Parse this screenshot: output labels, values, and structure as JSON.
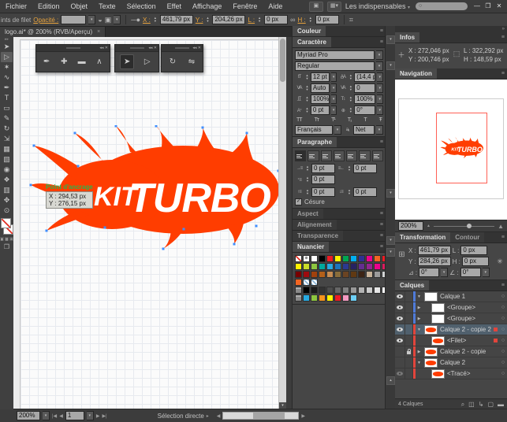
{
  "colors": {
    "logo": "#ff3d00",
    "accent_orange": "#e8a33d",
    "layer_blue": "#4f7bd8",
    "layer_red": "#e2453c",
    "selection_row": "#50606d",
    "nav_frame": "#ff6055",
    "anchor": "#3f8fff",
    "guide_green": "#2db34a"
  },
  "menubar": {
    "items": [
      "Fichier",
      "Edition",
      "Objet",
      "Texte",
      "Sélection",
      "Effet",
      "Affichage",
      "Fenêtre",
      "Aide"
    ],
    "workspace": "Les indispensables",
    "search_placeholder": "",
    "window_buttons": [
      "—",
      "❐",
      "✕"
    ]
  },
  "controlbar": {
    "context": "ints de filet",
    "opacity_label": "Opacité :",
    "opacity_value": "",
    "x_label": "X :",
    "x": "461,79 px",
    "y_label": "Y :",
    "y": "204,26 px",
    "l_label": "L :",
    "l": "0 px",
    "h_label": "H :",
    "h": "0 px"
  },
  "tabbar": {
    "title": "logo.ai* @ 200% (RVB/Aperçu)",
    "close": "×"
  },
  "toolbar": {
    "tools": [
      {
        "name": "selection-tool",
        "glyph": "➤"
      },
      {
        "name": "direct-selection-tool",
        "glyph": "▷",
        "active": true
      },
      {
        "name": "magic-wand-tool",
        "glyph": "✶"
      },
      {
        "name": "lasso-tool",
        "glyph": "∿"
      },
      {
        "name": "pen-tool",
        "glyph": "✒"
      },
      {
        "name": "type-tool",
        "glyph": "T"
      },
      {
        "name": "rectangle-tool",
        "glyph": "▭"
      },
      {
        "name": "pencil-tool",
        "glyph": "✎"
      },
      {
        "name": "rotate-tool",
        "glyph": "↻"
      },
      {
        "name": "scale-tool",
        "glyph": "⇲"
      },
      {
        "name": "mesh-tool",
        "glyph": "▦"
      },
      {
        "name": "gradient-tool",
        "glyph": "▧"
      },
      {
        "name": "eyedropper-tool",
        "glyph": "◉"
      },
      {
        "name": "blend-tool",
        "glyph": "❖"
      },
      {
        "name": "column-graph-tool",
        "glyph": "▥"
      },
      {
        "name": "hand-tool",
        "glyph": "✥"
      },
      {
        "name": "zoom-tool",
        "glyph": "⊙"
      }
    ]
  },
  "palettes": [
    {
      "name": "pen-tools-palette",
      "buttons": [
        {
          "name": "pen-tool",
          "glyph": "✒"
        },
        {
          "name": "add-anchor-point-tool",
          "glyph": "✚"
        },
        {
          "name": "delete-anchor-point-tool",
          "glyph": "▬"
        },
        {
          "name": "convert-anchor-point-tool",
          "glyph": "∧"
        }
      ]
    },
    {
      "name": "selection-tools-palette",
      "buttons": [
        {
          "name": "selection-tool",
          "glyph": "➤",
          "active": true
        },
        {
          "name": "direct-selection-tool",
          "glyph": "▷"
        }
      ]
    },
    {
      "name": "rotate-tools-palette",
      "buttons": [
        {
          "name": "rotate-tool",
          "glyph": "↻"
        },
        {
          "name": "reflect-tool",
          "glyph": "⇋"
        }
      ]
    }
  ],
  "canvas": {
    "tooltip": {
      "label": "Point d'ancrage",
      "x": "X : 294,53 px",
      "y": "Y : 276,15 px"
    }
  },
  "logo": {
    "kit": "KIT",
    "turbo": "TURBO",
    "anchors": [
      [
        6,
        26
      ],
      [
        2,
        76
      ],
      [
        22,
        134
      ],
      [
        58,
        10
      ],
      [
        110,
        1
      ],
      [
        161,
        1
      ],
      [
        220,
        3
      ],
      [
        276,
        10
      ],
      [
        316,
        58
      ],
      [
        318,
        102
      ],
      [
        288,
        128
      ],
      [
        260,
        151
      ],
      [
        196,
        132
      ],
      [
        170,
        157
      ],
      [
        96,
        130
      ],
      [
        62,
        52
      ]
    ]
  },
  "color_panel": {
    "title": "Couleur"
  },
  "character": {
    "title": "Caractère",
    "font": "Myriad Pro",
    "style": "Regular",
    "size": "12 pt",
    "leading": "(14,4 pt)",
    "kerning": "Auto",
    "tracking": "0",
    "h_scale": "100%",
    "v_scale": "100%",
    "baseline": "0 pt",
    "rotation": "0°",
    "tt_buttons": [
      "TT",
      "Tт",
      "T¹",
      "T₁",
      "T",
      "Ŧ"
    ],
    "language": "Français",
    "anti_alias": "Net"
  },
  "paragraph": {
    "title": "Paragraphe",
    "align_buttons": [
      "align-left",
      "align-center",
      "align-right",
      "justify-last-left",
      "justify-last-center",
      "justify-last-right",
      "justify-all"
    ],
    "indent_left": "0 pt",
    "indent_right": "0 pt",
    "indent_first": "0 pt",
    "space_before": "0 pt",
    "space_after": "0 pt",
    "hyphenate_label": "Césure",
    "hyphenate_checked": "✓"
  },
  "collapsed_panels": [
    "Aspect",
    "Alignement",
    "Transparence"
  ],
  "swatches": {
    "title": "Nuancier",
    "rows": [
      [
        "none",
        "registration",
        "#ffffff",
        "#000000",
        "#ed1c24",
        "#fff200",
        "#00a651",
        "#00aeef",
        "#2e3192",
        "#ec008c",
        "#f26522",
        "#ed1c24",
        "#f7941d",
        "#ffc20e"
      ],
      [
        "#fff200",
        "#cadb2a",
        "#8dc63f",
        "#00a99d",
        "#27aae1",
        "#1c75bc",
        "#2b3990",
        "#262262",
        "#652d90",
        "#92278f",
        "#ec008c",
        "#db1c5f",
        "#be1e2d",
        "#9e1f63"
      ],
      [
        "#790000",
        "#9e0b0f",
        "#a0410d",
        "#b4601a",
        "#c68c53",
        "#8a6d3b",
        "#6b4423",
        "#603913",
        "#3c2415",
        "#c7b299",
        "#9b9b9b",
        "#d1d3d4",
        "pattern",
        "pattern"
      ],
      [
        "#f26522",
        "pattern",
        "pattern"
      ],
      [
        "folder",
        "#000000",
        "#1a1a1a",
        "#333333",
        "#4d4d4d",
        "#666666",
        "#808080",
        "#999999",
        "#b3b3b3",
        "#cccccc",
        "#e6e6e6",
        "#ffffff"
      ],
      [
        "folder",
        "#27aae1",
        "#8dc63f",
        "#f7941d",
        "#fff200",
        "#ed1c24",
        "#f49ac1",
        "#6dcff6"
      ]
    ]
  },
  "infos": {
    "title": "Infos",
    "x_label": "X :",
    "x": "272,046 px",
    "y_label": "Y :",
    "y": "200,746 px",
    "l_label": "L :",
    "l": "322,292 px",
    "h_label": "H :",
    "h": "148,59 px"
  },
  "navigation": {
    "title": "Navigation",
    "zoom": "200%"
  },
  "transform": {
    "tabs": [
      "Transformation",
      "Contour"
    ],
    "x_label": "X :",
    "x": "461,79 px",
    "y_label": "Y :",
    "y": "284,26 px",
    "l_label": "L :",
    "l": "0 px",
    "h_label": "H :",
    "h": "0 px",
    "angle_label": "⊿ :",
    "angle": "0°",
    "shear_label": "∠ :",
    "shear": "0°"
  },
  "layers": {
    "title": "Calques",
    "footer": "4 Calques",
    "footer_icons": [
      "⌕",
      "◫",
      "↳",
      "▢",
      "▬"
    ],
    "rows": [
      {
        "name": "Calque 1",
        "eye": "on",
        "lock": false,
        "expand": "down",
        "color": "blue",
        "thumb": "white",
        "indent": 0,
        "selected": false,
        "indicator": false
      },
      {
        "name": "<Groupe>",
        "eye": "on",
        "lock": false,
        "expand": "right",
        "color": "blue",
        "thumb": "white",
        "indent": 1,
        "selected": false,
        "indicator": false
      },
      {
        "name": "<Groupe>",
        "eye": "on",
        "lock": false,
        "expand": "right",
        "color": "blue",
        "thumb": "white",
        "indent": 1,
        "selected": false,
        "indicator": false
      },
      {
        "name": "Calque 2 - copie 2",
        "eye": "on",
        "lock": false,
        "expand": "down",
        "color": "red",
        "thumb": "logo",
        "indent": 0,
        "selected": true,
        "indicator": true
      },
      {
        "name": "<Filet>",
        "eye": "on",
        "lock": false,
        "expand": "none",
        "color": "red",
        "thumb": "logo",
        "indent": 1,
        "selected": false,
        "indicator": true
      },
      {
        "name": "Calque 2 - copie",
        "eye": "off",
        "lock": true,
        "expand": "right",
        "color": "red",
        "thumb": "logo",
        "indent": 0,
        "selected": false,
        "indicator": false
      },
      {
        "name": "Calque 2",
        "eye": "off",
        "lock": false,
        "expand": "down",
        "color": "red",
        "thumb": "logo",
        "indent": 0,
        "selected": false,
        "indicator": false
      },
      {
        "name": "<Tracé>",
        "eye": "dim",
        "lock": false,
        "expand": "none",
        "color": "red",
        "thumb": "logo",
        "indent": 1,
        "selected": false,
        "indicator": false
      }
    ]
  },
  "dockstrip": {
    "icons": [
      [
        12,
        "▾"
      ],
      [
        45,
        "▾"
      ],
      [
        207,
        "▾"
      ],
      [
        267,
        "▾"
      ],
      [
        282,
        "▾"
      ],
      [
        445,
        "▴"
      ]
    ]
  },
  "statusbar": {
    "zoom": "200%",
    "page": "1",
    "tool": "Sélection directe"
  }
}
